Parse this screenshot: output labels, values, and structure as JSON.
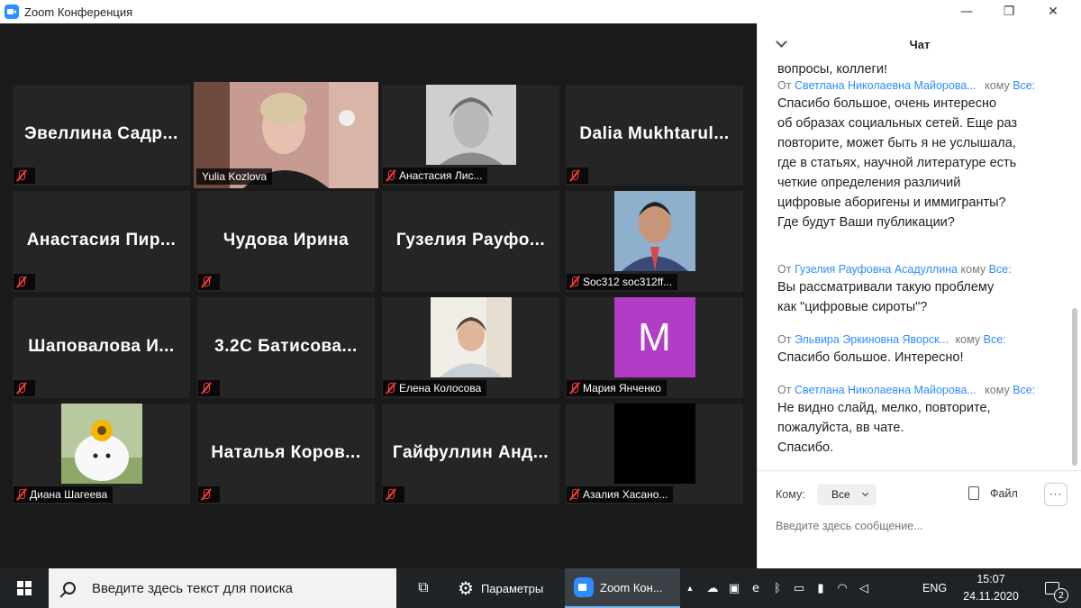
{
  "window": {
    "title": "Zoom Конференция",
    "controls": {
      "minimize": "—",
      "restore": "❐",
      "close": "✕"
    }
  },
  "gallery": {
    "tiles": [
      {
        "name": "Эвеллина Садр...",
        "label": ""
      },
      {
        "name": "",
        "label": "Yulia Kozlova"
      },
      {
        "name": "",
        "label": "Анастасия Лис..."
      },
      {
        "name": "Dalia Mukhtarul...",
        "label": ""
      },
      {
        "name": "Анастасия Пир...",
        "label": ""
      },
      {
        "name": "Чудова Ирина",
        "label": ""
      },
      {
        "name": "Гузелия Рауфо...",
        "label": ""
      },
      {
        "name": "",
        "label": "Soc312 soc312ff..."
      },
      {
        "name": "Шаповалова И...",
        "label": ""
      },
      {
        "name": "3.2С  Батисова...",
        "label": ""
      },
      {
        "name": "",
        "label": "Елена Колосова"
      },
      {
        "name": "",
        "label": "Мария Янченко",
        "avatar_letter": "M"
      },
      {
        "name": "",
        "label": "Диана Шагеева"
      },
      {
        "name": "Наталья Коров...",
        "label": ""
      },
      {
        "name": "Гайфуллин Анд...",
        "label": ""
      },
      {
        "name": "",
        "label": "Азалия Хасано..."
      }
    ]
  },
  "chat": {
    "title": "Чат",
    "partial_top": "вопросы, коллеги!",
    "messages": [
      {
        "from_prefix": "От",
        "sender": "Светлана Николаевна Майорова...",
        "to_prefix": "кому",
        "recipient": "Все:",
        "lines": [
          "Спасибо большое, очень интересно",
          "об образах социальных сетей. Еще раз",
          "повторите, может быть я не услышала,",
          "где в статьях, научной литературе есть",
          "четкие определения различий",
          "цифровые аборигены и иммигранты?",
          "Где будут Ваши публикации?"
        ]
      },
      {
        "from_prefix": "От",
        "sender": "Гузелия Рауфовна Асадуллина",
        "to_prefix": "кому",
        "recipient": "Все:",
        "lines": [
          "Вы рассматривали такую проблему",
          "как \"цифровые сироты\"?"
        ]
      },
      {
        "from_prefix": "От",
        "sender": "Эльвира Эркиновна Яворск...",
        "to_prefix": "кому",
        "recipient": "Все:",
        "lines": [
          "Спасибо большое. Интересно!"
        ]
      },
      {
        "from_prefix": "От",
        "sender": "Светлана Николаевна Майорова...",
        "to_prefix": "кому",
        "recipient": "Все:",
        "lines": [
          "Не видно слайд, мелко, повторите,",
          "пожалуйста, вв чате.",
          "Спасибо."
        ]
      }
    ],
    "footer": {
      "to_label": "Кому:",
      "to_value": "Все",
      "file_label": "Файл",
      "more": "···",
      "input_placeholder": "Введите здесь сообщение..."
    }
  },
  "taskbar": {
    "search_placeholder": "Введите здесь текст для поиска",
    "settings_label": "Параметры",
    "zoom_label": "Zoom Кон...",
    "language": "ENG",
    "time": "15:07",
    "date": "24.11.2020",
    "notifications": "2"
  },
  "colors": {
    "active_speaker": "#cde05a",
    "link": "#2d8cff",
    "muted": "#ff3b3b",
    "avatar_purple": "#b23cc6"
  }
}
